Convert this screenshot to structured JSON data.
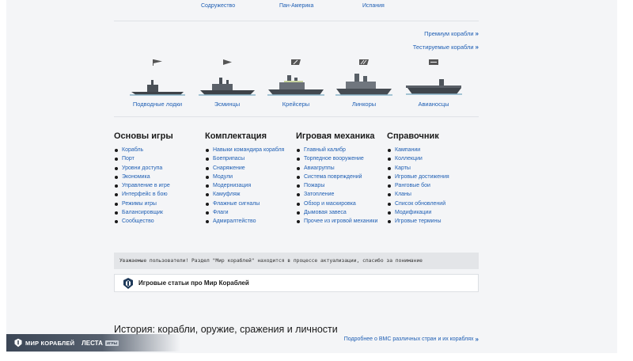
{
  "top_nations": [
    "Содружество",
    "Пан-Америка",
    "Испания"
  ],
  "links": {
    "premium": "Премиум корабли",
    "test": "Тестируемые корабли",
    "history_more": "Подробнее о ВМС различных стран и их кораблях"
  },
  "ship_classes": [
    {
      "label": "Подводные лодки",
      "icon": "submarine-icon"
    },
    {
      "label": "Эсминцы",
      "icon": "destroyer-icon"
    },
    {
      "label": "Крейсеры",
      "icon": "cruiser-icon"
    },
    {
      "label": "Линкоры",
      "icon": "battleship-icon"
    },
    {
      "label": "Авианосцы",
      "icon": "aircraft-carrier-icon"
    }
  ],
  "columns": [
    {
      "title": "Основы игры",
      "items": [
        "Корабль",
        "Порт",
        "Уровни доступа",
        "Экономика",
        "Управление в игре",
        "Интерфейс в бою",
        "Режимы игры",
        "Балансировщик",
        "Сообщество"
      ]
    },
    {
      "title": "Комплектация",
      "items": [
        "Навыки командира корабля",
        "Боеприпасы",
        "Снаряжение",
        "Модули",
        "Модернизация",
        "Камуфляж",
        "Флажные сигналы",
        "Флаги",
        "Адмиралтейство"
      ]
    },
    {
      "title": "Игровая механика",
      "items": [
        "Главный калибр",
        "Торпедное вооружение",
        "Авиагруппы",
        "Система повреждений",
        "Пожары",
        "Затопление",
        "Обзор и маскировка",
        "Дымовая завеса",
        "Прочее из игровой механики"
      ]
    },
    {
      "title": "Справочник",
      "items": [
        "Кампании",
        "Коллекции",
        "Карты",
        "Игровые достижения",
        "Ранговые бои",
        "Кланы",
        "Список обновлений",
        "Модификации",
        "Игровые термины"
      ]
    }
  ],
  "notice": "Уважаемые пользователи! Раздел \"Мир кораблей\" находится в процессе актуализации, спасибо за понимание",
  "game_articles": "Игровые статьи про Мир Кораблей",
  "history_heading": "История: корабли, оружие, сражения и личности",
  "footer": {
    "brand": "МИР КОРАБЛЕЙ",
    "publisher": "ЛЕСТА",
    "badge": "ИГРЫ"
  }
}
